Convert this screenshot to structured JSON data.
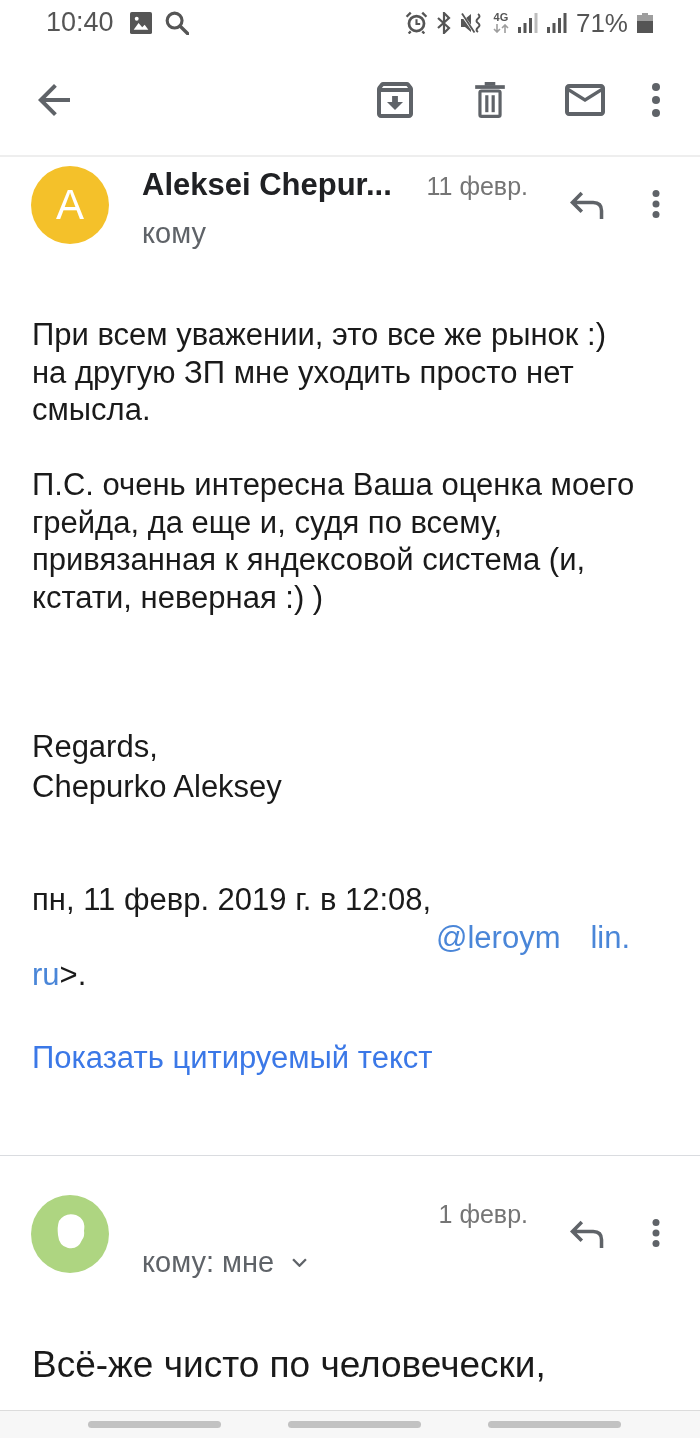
{
  "status_bar": {
    "time": "10:40",
    "network": "4G",
    "battery": "71%"
  },
  "messages": [
    {
      "avatar": {
        "kind": "letter",
        "letter": "A",
        "color": "#f4c12a"
      },
      "sender": "Aleksei Chepur...",
      "date": "11 февр.",
      "recipient": "кому",
      "paragraphs": [
        [
          "При всем уважении, это все же рынок :)",
          "на другую ЗП мне уходить просто нет",
          "смысла."
        ],
        [
          "П.С. очень интересна Ваша оценка моего",
          "грейда, да еще и, судя по всему,",
          "привязанная к яндексовой система (и,",
          "кстати, неверная :) )"
        ]
      ],
      "signature": [
        "Regards,",
        "Chepurko Aleksey"
      ],
      "quote_intro": {
        "text": "пн, 11 февр. 2019 г. в 12:08,",
        "email_parts": [
          "@leroym",
          "lin.",
          "ru"
        ],
        "tail": ">."
      },
      "show_quoted": "Показать цитируемый текст"
    },
    {
      "avatar": {
        "kind": "masked",
        "color": "#aed581"
      },
      "date": "1 февр.",
      "recipient": "кому: мне",
      "recipient_menu": true,
      "paragraphs": [
        [
          "Всё-же чисто по человечески,"
        ]
      ]
    }
  ]
}
